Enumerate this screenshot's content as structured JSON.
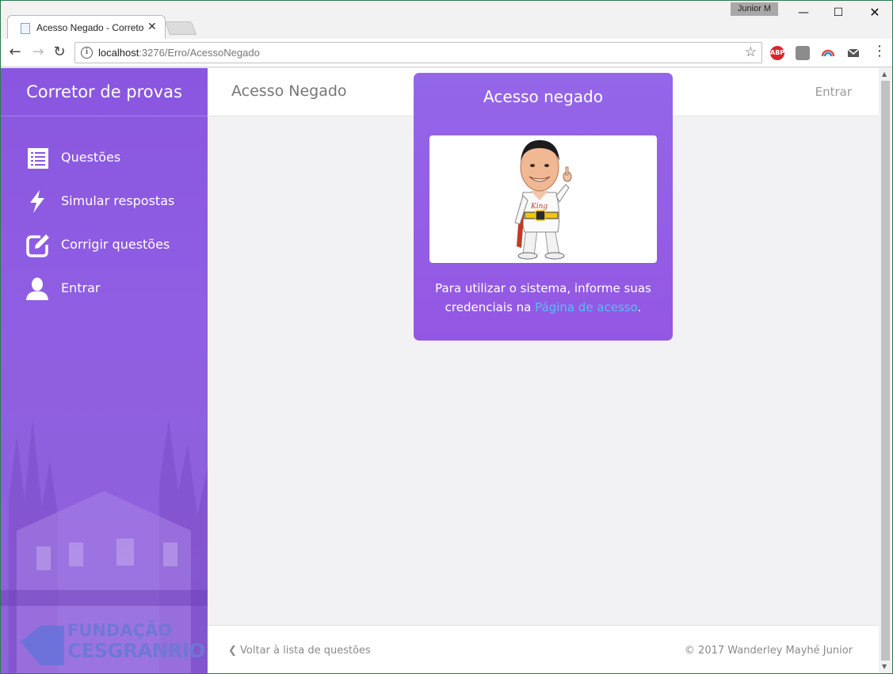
{
  "browser": {
    "profile_name": "Junior M",
    "tab_title": "Acesso Negado - Correto",
    "url_host": "localhost",
    "url_path": ":3276/Erro/AcessoNegado",
    "ext_abp": "ABP"
  },
  "sidebar": {
    "brand": "Corretor de provas",
    "items": [
      {
        "label": "Questões",
        "icon": "list-icon"
      },
      {
        "label": "Simular respostas",
        "icon": "lightning-icon"
      },
      {
        "label": "Corrigir questões",
        "icon": "edit-icon"
      },
      {
        "label": "Entrar",
        "icon": "user-icon"
      }
    ],
    "logo_line1": "FUNDAÇÃO",
    "logo_line2": "CESGRANRIO"
  },
  "header": {
    "title": "Acesso Negado",
    "login_link": "Entrar"
  },
  "card": {
    "title": "Acesso negado",
    "text_line1": "Para utilizar o sistema, informe suas",
    "text_line2_prefix": "credenciais na ",
    "link_text": "Página de acesso",
    "text_suffix": "."
  },
  "footer": {
    "back_link": "Voltar à lista de questões",
    "copyright": "© 2017 Wanderley Mayhé Junior"
  },
  "colors": {
    "sidebar": "#8a56e0",
    "card": "#9466e8",
    "link": "#4fc3f0"
  }
}
